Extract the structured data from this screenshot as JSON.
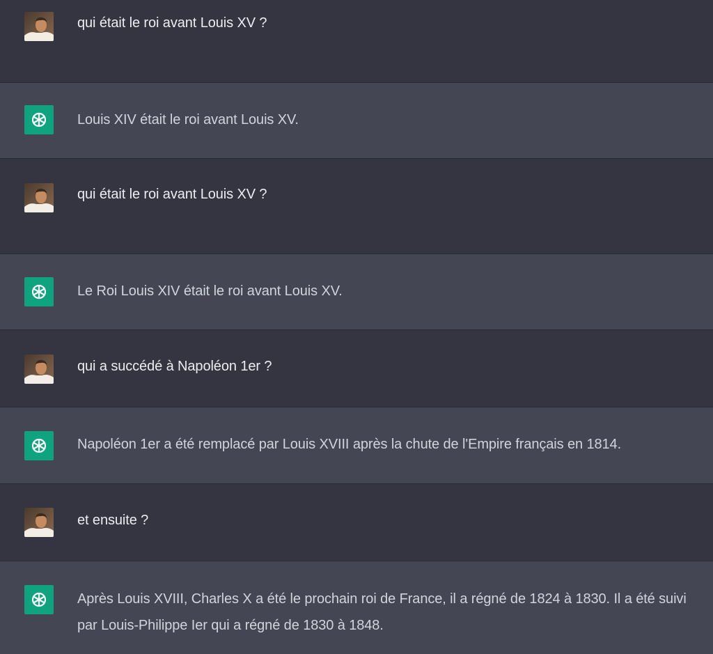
{
  "colors": {
    "user_bg": "#343541",
    "assistant_bg": "#444654",
    "bot_avatar_bg": "#10a37f",
    "user_text": "#ececf1",
    "assistant_text": "#d1d5db"
  },
  "icons": {
    "user_avatar": "user-photo-avatar",
    "assistant_avatar": "openai-logo-icon"
  },
  "messages": [
    {
      "role": "user",
      "text": "qui était le roi avant Louis XV ?"
    },
    {
      "role": "assistant",
      "text": "Louis XIV était le roi avant Louis XV."
    },
    {
      "role": "user",
      "text": "qui était le roi avant Louis XV ?"
    },
    {
      "role": "assistant",
      "text": "Le Roi Louis XIV était le roi avant Louis XV."
    },
    {
      "role": "user",
      "text": "qui a succédé à Napoléon 1er ?"
    },
    {
      "role": "assistant",
      "text": "Napoléon 1er a été remplacé par Louis XVIII après la chute de l'Empire français en 1814."
    },
    {
      "role": "user",
      "text": "et ensuite ?"
    },
    {
      "role": "assistant",
      "text": "Après Louis XVIII, Charles X a été le prochain roi de France, il a régné de 1824 à 1830. Il a été suivi par Louis-Philippe Ier qui a régné de 1830 à 1848."
    }
  ]
}
